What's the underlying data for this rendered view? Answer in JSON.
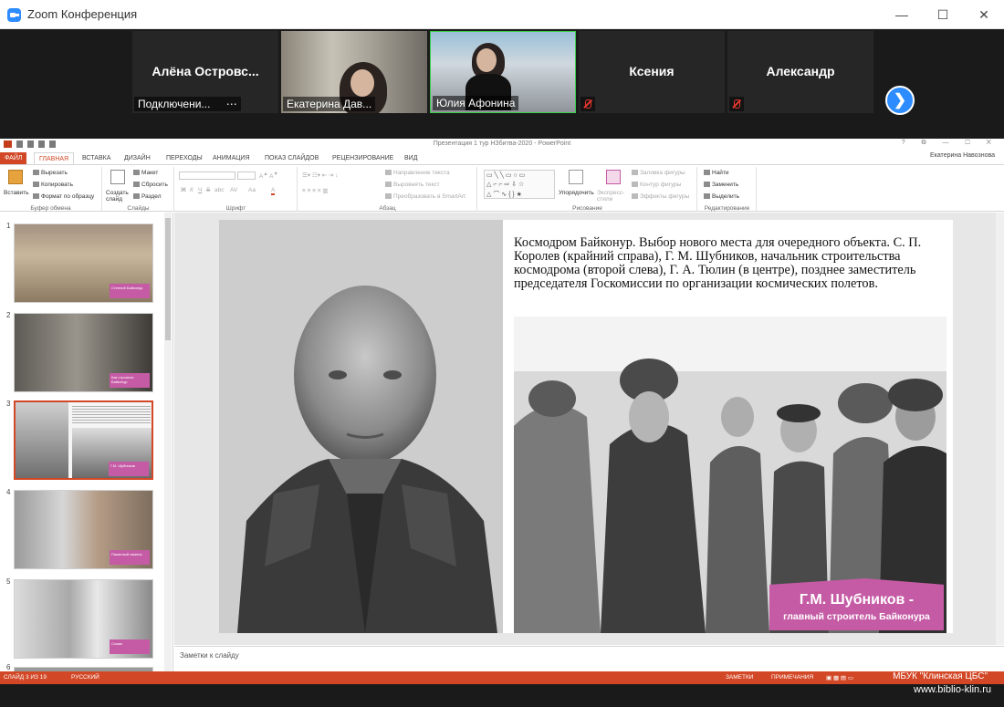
{
  "zoom": {
    "window_title": "Zoom Конференция",
    "window_controls": {
      "minimize": "—",
      "maximize": "☐",
      "close": "✕"
    },
    "participants": [
      {
        "name": "Алёна  Островс...",
        "caption": "Подключени...",
        "caption_extra": "⋯",
        "video": false
      },
      {
        "name": "",
        "caption": "Екатерина Дав...",
        "video": true
      },
      {
        "name": "",
        "caption": "Юлия Афонина",
        "video": true,
        "active_speaker": true
      },
      {
        "name": "Ксения",
        "caption": "",
        "muted": true,
        "video": false
      },
      {
        "name": "Александр",
        "caption": "",
        "muted": true,
        "video": false
      }
    ],
    "next_page_icon": "chevron-right-icon",
    "next_page_glyph": "❯"
  },
  "powerpoint": {
    "doc_title": "Презентация 1 тур НЗбитва-2020 - PowerPoint",
    "title_controls": "? ⧉ — ☐ ✕",
    "tabs": [
      "ФАЙЛ",
      "ГЛАВНАЯ",
      "ВСТАВКА",
      "ДИЗАЙН",
      "ПЕРЕХОДЫ",
      "АНИМАЦИЯ",
      "ПОКАЗ СЛАЙДОВ",
      "РЕЦЕНЗИРОВАНИЕ",
      "ВИД"
    ],
    "active_tab": "ГЛАВНАЯ",
    "user": "Екатерина Навознова",
    "ribbon": {
      "clipboard": {
        "paste": "Вставить",
        "cut": "Вырезать",
        "copy": "Копировать",
        "format_painter": "Формат по образцу",
        "label": "Буфер обмена"
      },
      "slides": {
        "new_slide": "Создать слайд",
        "layout": "Макет",
        "reset": "Сбросить",
        "section": "Раздел",
        "label": "Слайды"
      },
      "font": {
        "bold": "Ж",
        "italic": "К",
        "underline": "Ч",
        "strike": "S",
        "shadow": "abc",
        "spacing": "AV",
        "case": "Aa",
        "color": "A",
        "label": "Шрифт"
      },
      "paragraph": {
        "text_direction": "Направление текста",
        "align_text": "Выровнять текст",
        "smartart": "Преобразовать в SmartArt",
        "label": "Абзац"
      },
      "drawing": {
        "arrange": "Упорядочить",
        "quick_styles": "Экспресс-стили",
        "shape_fill": "Заливка фигуры",
        "shape_outline": "Контур фигуры",
        "shape_effects": "Эффекты фигуры",
        "label": "Рисование"
      },
      "editing": {
        "find": "Найти",
        "replace": "Заменить",
        "select": "Выделить",
        "label": "Редактирование"
      }
    },
    "thumbnails": [
      {
        "num": "1",
        "tag": "Степной Байконур"
      },
      {
        "num": "2",
        "tag": "Как строился Байконур"
      },
      {
        "num": "3",
        "tag": "Г.М. Шубников",
        "selected": true
      },
      {
        "num": "4",
        "tag": "Памятный камень"
      },
      {
        "num": "5",
        "tag": "Слава"
      },
      {
        "num": "6",
        "tag": ""
      }
    ],
    "slide": {
      "caption": "Космодром Байконур. Выбор нового места для очередного объекта. С. П. Королев (крайний справа), Г. М. Шубников, начальник строительства космодрома (второй слева), Г. А. Тюлин (в центре), позднее заместитель председателя Госкомиссии по организации космических полетов.",
      "banner_title": "Г.М. Шубников -",
      "banner_subtitle": "главный строитель Байконура"
    },
    "notes_placeholder": "Заметки к слайду",
    "status": {
      "slide_counter": "СЛАЙД 3 ИЗ 19",
      "language": "РУССКИЙ",
      "notes": "ЗАМЕТКИ",
      "comments": "ПРИМЕЧАНИЯ"
    }
  },
  "watermark": {
    "line1": "МБУК \"Клинская ЦБС\"",
    "line2": "www.biblio-klin.ru"
  },
  "colors": {
    "zoom_blue": "#2d8cff",
    "ppt_accent": "#d24726",
    "banner_pink": "#c55ba5",
    "mute_red": "#e8372f"
  }
}
